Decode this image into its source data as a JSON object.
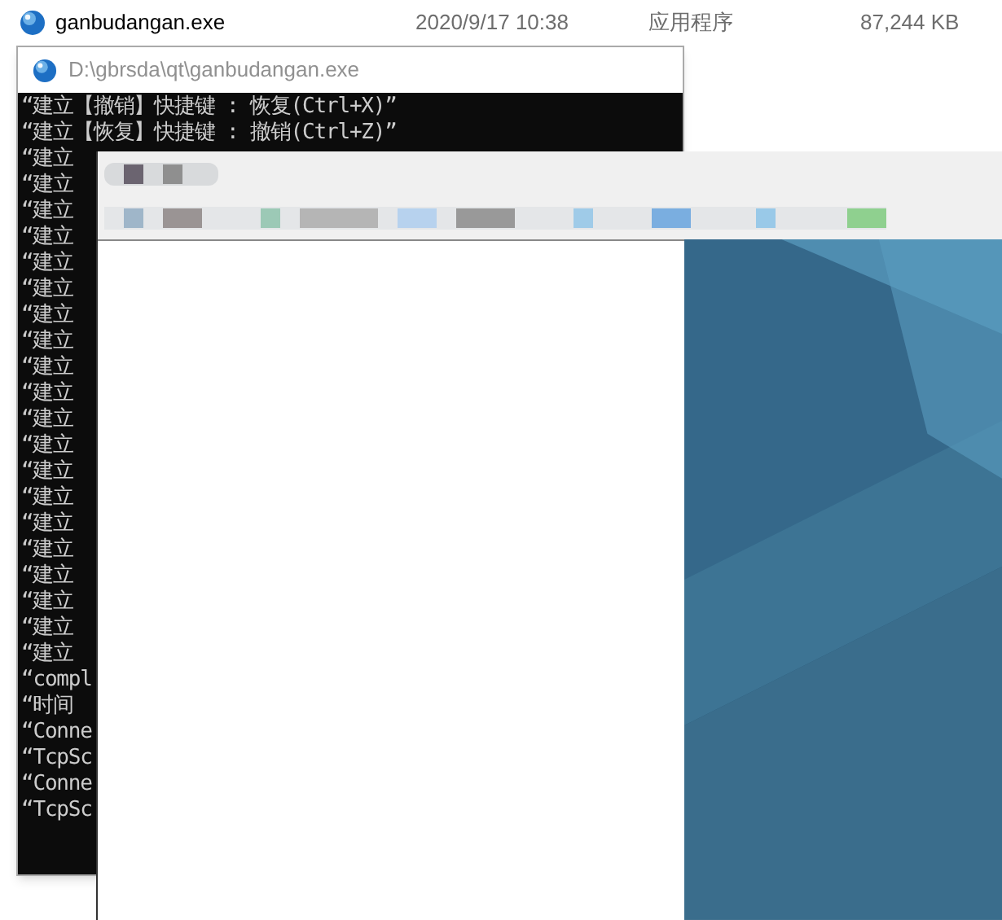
{
  "file_row": {
    "name": "ganbudangan.exe",
    "modified": "2020/9/17 10:38",
    "type": "应用程序",
    "size": "87,244 KB"
  },
  "console": {
    "title": "D:\\gbrsda\\qt\\ganbudangan.exe",
    "lines": [
      "“建立【撤销】快捷键 : 恢复(Ctrl+X)”",
      "“建立【恢复】快捷键 : 撤销(Ctrl+Z)”",
      "“建立",
      "“建立",
      "“建立",
      "“建立",
      "“建立",
      "“建立",
      "“建立",
      "“建立",
      "“建立",
      "“建立",
      "“建立",
      "“建立",
      "“建立",
      "“建立",
      "“建立",
      "“建立",
      "“建立",
      "“建立",
      "“建立",
      "“建立",
      "“compl",
      "“时间",
      "“Conne",
      "“TcpSc",
      "“Conne",
      "“TcpSc"
    ]
  }
}
